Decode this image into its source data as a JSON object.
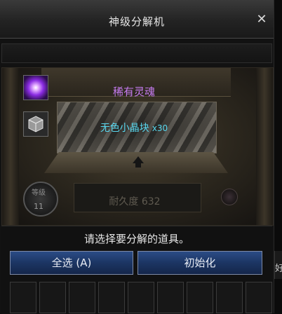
{
  "window": {
    "title": "神级分解机",
    "close_glyph": "✕"
  },
  "machine": {
    "rare_item_label": "稀有灵魂",
    "crystal_item_label": "无色小晶块",
    "crystal_quantity": "x30",
    "durability_label": "耐久度 632",
    "level_badge_top": "等级",
    "level_badge_number": "11",
    "icons": {
      "rare_item": "purple-soul-icon",
      "crystal_item": "colorless-crystal-cube-icon"
    }
  },
  "panel": {
    "prompt": "请选择要分解的道具。",
    "select_all_label": "全选 (A)",
    "reset_label": "初始化"
  },
  "edge_text": "好",
  "colors": {
    "rare_text": "#c67cf0",
    "crystal_text": "#58d8f0",
    "button_blue": "#1c3563"
  }
}
